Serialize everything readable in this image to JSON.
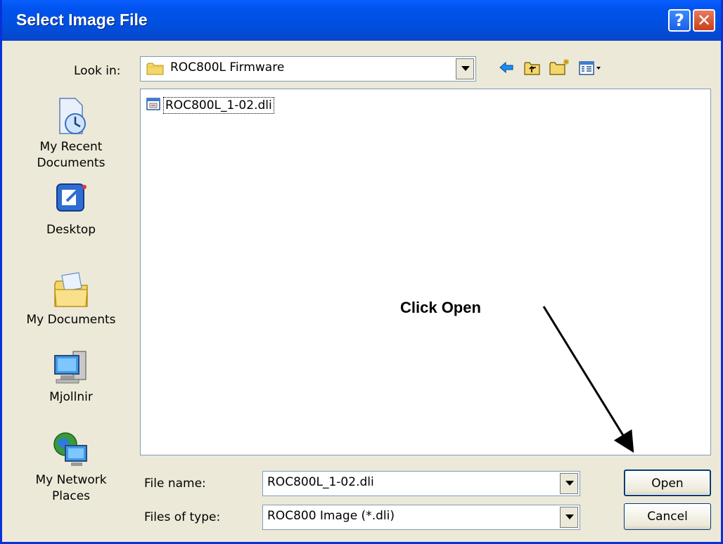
{
  "window": {
    "title": "Select Image File"
  },
  "titlebar": {
    "help_label": "?",
    "close_label": "✕"
  },
  "lookin": {
    "label": "Look in:",
    "value": "ROC800L Firmware"
  },
  "toolbar": {
    "icons": [
      "back-icon",
      "up-folder-icon",
      "new-folder-icon",
      "view-menu-icon"
    ]
  },
  "places": [
    {
      "label_lines": [
        "My Recent",
        "Documents"
      ],
      "icon": "recent-documents-icon"
    },
    {
      "label_lines": [
        "Desktop"
      ],
      "icon": "desktop-icon"
    },
    {
      "label_lines": [
        "My Documents"
      ],
      "icon": "my-documents-icon"
    },
    {
      "label_lines": [
        "Mjollnir"
      ],
      "icon": "computer-icon"
    },
    {
      "label_lines": [
        "My Network",
        "Places"
      ],
      "icon": "network-places-icon"
    }
  ],
  "files": [
    {
      "name": "ROC800L_1-02.dli",
      "icon": "dli-file-icon"
    }
  ],
  "filename": {
    "label": "File name:",
    "value": "ROC800L_1-02.dli"
  },
  "filetype": {
    "label": "Files of type:",
    "value": "ROC800 Image (*.dli)"
  },
  "buttons": {
    "open": "Open",
    "cancel": "Cancel"
  },
  "annotation": {
    "text": "Click Open"
  }
}
